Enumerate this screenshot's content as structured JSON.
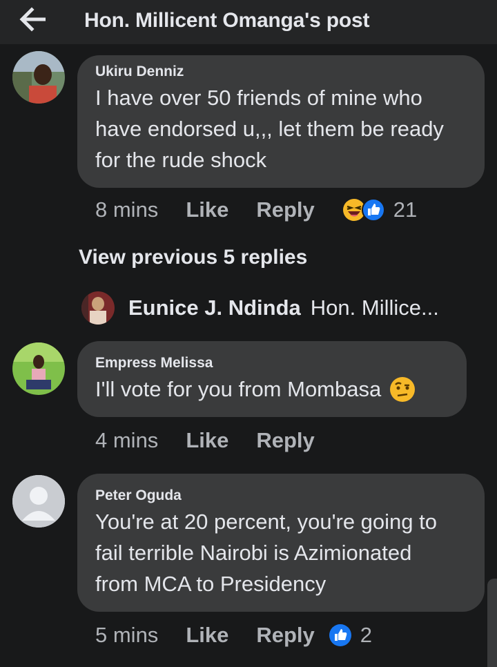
{
  "header": {
    "title": "Hon. Millicent Omanga's post",
    "back_icon": "arrow-left-icon"
  },
  "comments": [
    {
      "author": "Ukiru Denniz",
      "text": "I have over 50 friends of mine who\nhave endorsed u,,, let them be ready\nfor the rude shock",
      "time": "8 mins",
      "like_label": "Like",
      "reply_label": "Reply",
      "reactions": [
        "laughing-emoji-icon",
        "thumbs-up-reaction-icon"
      ],
      "reaction_count": "21"
    },
    {
      "author": "Empress Melissa",
      "text": "I'll vote for you from Mombasa",
      "emoji": "raised-eyebrow-emoji-icon",
      "time": "4 mins",
      "like_label": "Like",
      "reply_label": "Reply"
    },
    {
      "author": "Peter Oguda",
      "text": "You're at 20 percent, you're going to\nfail terrible Nairobi is Azimionated\nfrom MCA to Presidency",
      "time": "5 mins",
      "like_label": "Like",
      "reply_label": "Reply",
      "reactions": [
        "thumbs-up-reaction-icon"
      ],
      "reaction_count": "2"
    }
  ],
  "view_previous": "View previous 5 replies",
  "latest_reply": {
    "author": "Eunice J. Ndinda",
    "snippet": "Hon. Millice..."
  },
  "colors": {
    "background": "#18191a",
    "bubble": "#3a3b3c",
    "text": "#e4e6eb",
    "muted": "#b0b3b8",
    "like_blue": "#1877f2"
  }
}
